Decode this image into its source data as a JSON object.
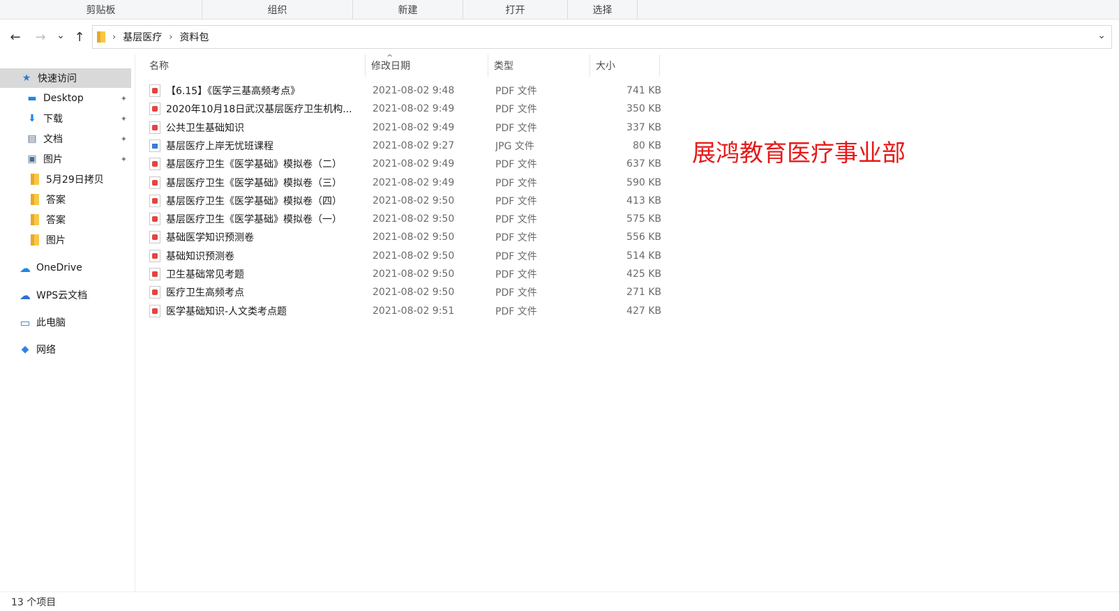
{
  "ribbon": {
    "groups": [
      "剪贴板",
      "组织",
      "新建",
      "打开",
      "选择"
    ]
  },
  "nav": {
    "back": "←",
    "forward": "→",
    "recent": "⌄",
    "up": "↑",
    "breadcrumb": [
      "基层医疗",
      "资料包"
    ],
    "separator": "›",
    "dropdown": "⌄"
  },
  "sidebar": {
    "items": [
      {
        "label": "快速访问",
        "icon": "star-icon",
        "glyph": "★",
        "color": "#2b7cd3"
      },
      {
        "label": "Desktop",
        "icon": "desktop-icon",
        "glyph": "▬",
        "color": "#1e88e5"
      },
      {
        "label": "下载",
        "icon": "download-arrow-icon",
        "glyph": "⬇",
        "color": "#1e88e5"
      },
      {
        "label": "文档",
        "icon": "document-icon",
        "glyph": "▤",
        "color": "#5a6b7b"
      },
      {
        "label": "图片",
        "icon": "pictures-icon",
        "glyph": "▣",
        "color": "#4a6c8c"
      },
      {
        "label": "5月29日拷贝",
        "icon": "folder-icon"
      },
      {
        "label": "答案",
        "icon": "folder-icon"
      },
      {
        "label": "答案",
        "icon": "folder-icon"
      },
      {
        "label": "图片",
        "icon": "folder-icon"
      },
      {
        "label": "OneDrive",
        "icon": "cloud-icon",
        "glyph": "☁",
        "color": "#1e88e5"
      },
      {
        "label": "WPS云文档",
        "icon": "wps-cloud-icon",
        "glyph": "☁",
        "color": "#2f6fd6"
      },
      {
        "label": "此电脑",
        "icon": "computer-icon",
        "glyph": "▭",
        "color": "#3d7dc8"
      },
      {
        "label": "网络",
        "icon": "network-icon",
        "glyph": "◆",
        "color": "#2f80ed"
      }
    ],
    "pin_glyph": "📌"
  },
  "columns": {
    "name": "名称",
    "date": "修改日期",
    "type": "类型",
    "size": "大小",
    "sort_caret": "^"
  },
  "files": [
    {
      "name": "【6.15】《医学三基高频考点》",
      "date": "2021-08-02 9:48",
      "type": "PDF 文件",
      "size": "741 KB",
      "kind": "pdf"
    },
    {
      "name": "2020年10月18日武汉基层医疗卫生机构...",
      "date": "2021-08-02 9:49",
      "type": "PDF 文件",
      "size": "350 KB",
      "kind": "pdf"
    },
    {
      "name": "公共卫生基础知识",
      "date": "2021-08-02 9:49",
      "type": "PDF 文件",
      "size": "337 KB",
      "kind": "pdf"
    },
    {
      "name": "基层医疗上岸无忧班课程",
      "date": "2021-08-02 9:27",
      "type": "JPG 文件",
      "size": "80 KB",
      "kind": "jpg"
    },
    {
      "name": "基层医疗卫生《医学基础》模拟卷（二）",
      "date": "2021-08-02 9:49",
      "type": "PDF 文件",
      "size": "637 KB",
      "kind": "pdf"
    },
    {
      "name": "基层医疗卫生《医学基础》模拟卷（三）",
      "date": "2021-08-02 9:49",
      "type": "PDF 文件",
      "size": "590 KB",
      "kind": "pdf"
    },
    {
      "name": "基层医疗卫生《医学基础》模拟卷（四）",
      "date": "2021-08-02 9:50",
      "type": "PDF 文件",
      "size": "413 KB",
      "kind": "pdf"
    },
    {
      "name": "基层医疗卫生《医学基础》模拟卷（一）",
      "date": "2021-08-02 9:50",
      "type": "PDF 文件",
      "size": "575 KB",
      "kind": "pdf"
    },
    {
      "name": "基础医学知识预测卷",
      "date": "2021-08-02 9:50",
      "type": "PDF 文件",
      "size": "556 KB",
      "kind": "pdf"
    },
    {
      "name": "基础知识预测卷",
      "date": "2021-08-02 9:50",
      "type": "PDF 文件",
      "size": "514 KB",
      "kind": "pdf"
    },
    {
      "name": "卫生基础常见考题",
      "date": "2021-08-02 9:50",
      "type": "PDF 文件",
      "size": "425 KB",
      "kind": "pdf"
    },
    {
      "name": "医疗卫生高频考点",
      "date": "2021-08-02 9:50",
      "type": "PDF 文件",
      "size": "271 KB",
      "kind": "pdf"
    },
    {
      "name": "医学基础知识-人文类考点题",
      "date": "2021-08-02 9:51",
      "type": "PDF 文件",
      "size": "427 KB",
      "kind": "pdf"
    }
  ],
  "watermark": "展鸿教育医疗事业部",
  "status": "13 个项目"
}
